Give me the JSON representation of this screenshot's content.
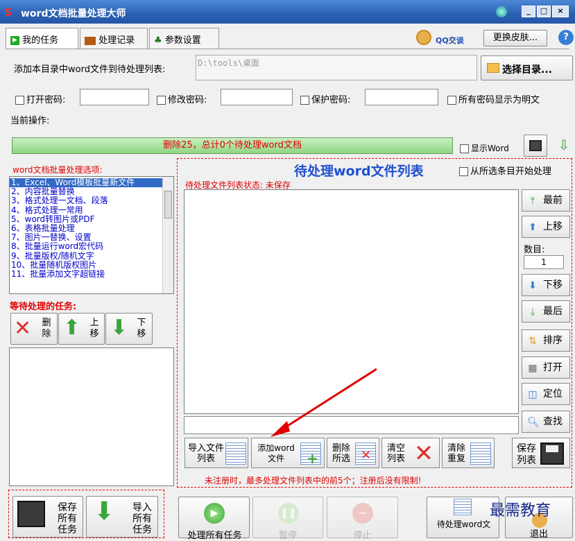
{
  "window": {
    "title": "word文档批量处理大师"
  },
  "tabs": [
    {
      "label": "我的任务"
    },
    {
      "label": "处理记录"
    },
    {
      "label": "参数设置"
    }
  ],
  "top_right": {
    "qq_label": "QQ交谈",
    "skin_button": "更换皮肤...",
    "help_icon": "?"
  },
  "dir": {
    "label": "添加本目录中word文件到待处理列表:",
    "value": "D:\\tools\\桌面",
    "select_button": "选择目录..."
  },
  "passwords": {
    "open": "打开密码:",
    "modify": "修改密码:",
    "protect": "保护密码:",
    "show_plain": "所有密码显示为明文"
  },
  "status": {
    "current_op_label": "当前操作:",
    "progress_text": "删除25，总计0个待处理word文档",
    "show_word": "显示Word"
  },
  "options": {
    "header": "word文档批量处理选项:",
    "items": [
      "1、Excel、Word模板批量新文件",
      "2、内容批量替换",
      "3、格式处理一文档、段落",
      "4、格式处理一常用",
      "5、word转图片或PDF",
      "6、表格批量处理",
      "7、图片一替换、设置",
      "8、批量运行word宏代码",
      "9、批量版权/随机文字",
      "10、批量随机版权图片",
      "11、批量添加文字超链接"
    ]
  },
  "pending_tasks": {
    "header": "等待处理的任务:",
    "delete": "删除",
    "up": "上移",
    "down": "下移"
  },
  "file_list": {
    "title": "待处理word文件列表",
    "from_selected": "从所选条目开始处理",
    "status": "待处理文件列表状态: 未保存"
  },
  "side_buttons": {
    "top": "最前",
    "up": "上移",
    "count_label": "数目:",
    "count_value": "1",
    "down": "下移",
    "bottom": "最后",
    "sort": "排序",
    "open": "打开",
    "locate": "定位",
    "find": "查找"
  },
  "list_buttons": {
    "import": "导入文件列表",
    "add": "添加word文件",
    "remove": "删除所选",
    "clear": "清空列表",
    "dedup": "清除重复",
    "save": "保存列表"
  },
  "notice": "未注册时，最多处理文件列表中的前5个；注册后没有限制!",
  "bottom": {
    "save_all": "保存所有任务",
    "import_all": "导入所有任务",
    "process_all": "处理所有任务",
    "pause": "暂停",
    "stop": "停止",
    "pending_list": "待处理word文",
    "exit": "退出"
  },
  "watermark": "最需教育"
}
